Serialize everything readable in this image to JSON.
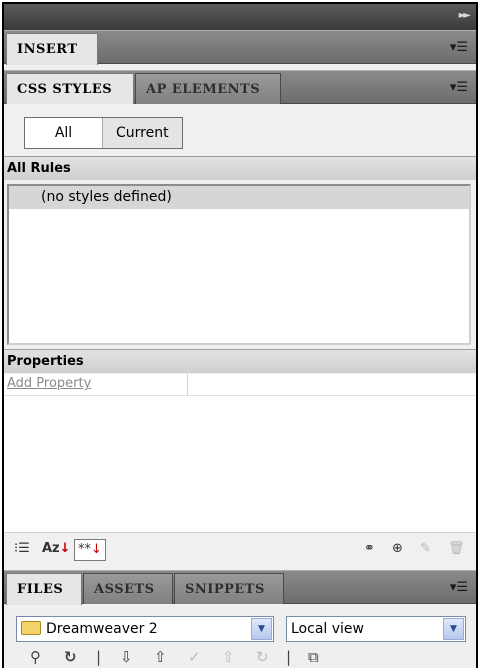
{
  "topbar": {
    "collapse_icon": "double-arrow-right-icon"
  },
  "insert_panel": {
    "tab_label": "INSERT",
    "menu_icon": "panel-menu-icon"
  },
  "css_panel": {
    "tabs": [
      {
        "label": "CSS STYLES",
        "active": true
      },
      {
        "label": "AP ELEMENTS",
        "active": false
      }
    ],
    "mode": {
      "all": "All",
      "current": "Current",
      "selected": "All"
    },
    "rules_header": "All Rules",
    "rules_empty": "(no styles defined)",
    "properties_header": "Properties",
    "add_property": "Add Property",
    "toolbar": {
      "show_category_icon": "category-view-icon",
      "sort_az_label": "Az",
      "show_set_label": "**"
    }
  },
  "files_panel": {
    "tabs": [
      {
        "label": "FILES",
        "active": true
      },
      {
        "label": "ASSETS",
        "active": false
      },
      {
        "label": "SNIPPETS",
        "active": false
      }
    ],
    "site_select": "Dreamweaver 2",
    "view_select": "Local view"
  },
  "colors": {
    "header_dark": "#3a3a3a",
    "tab_bar": "#7a7a7a",
    "selected_row": "#d6d6d6",
    "link_gray": "#8a8a8a",
    "flag_red": "#c00000"
  }
}
